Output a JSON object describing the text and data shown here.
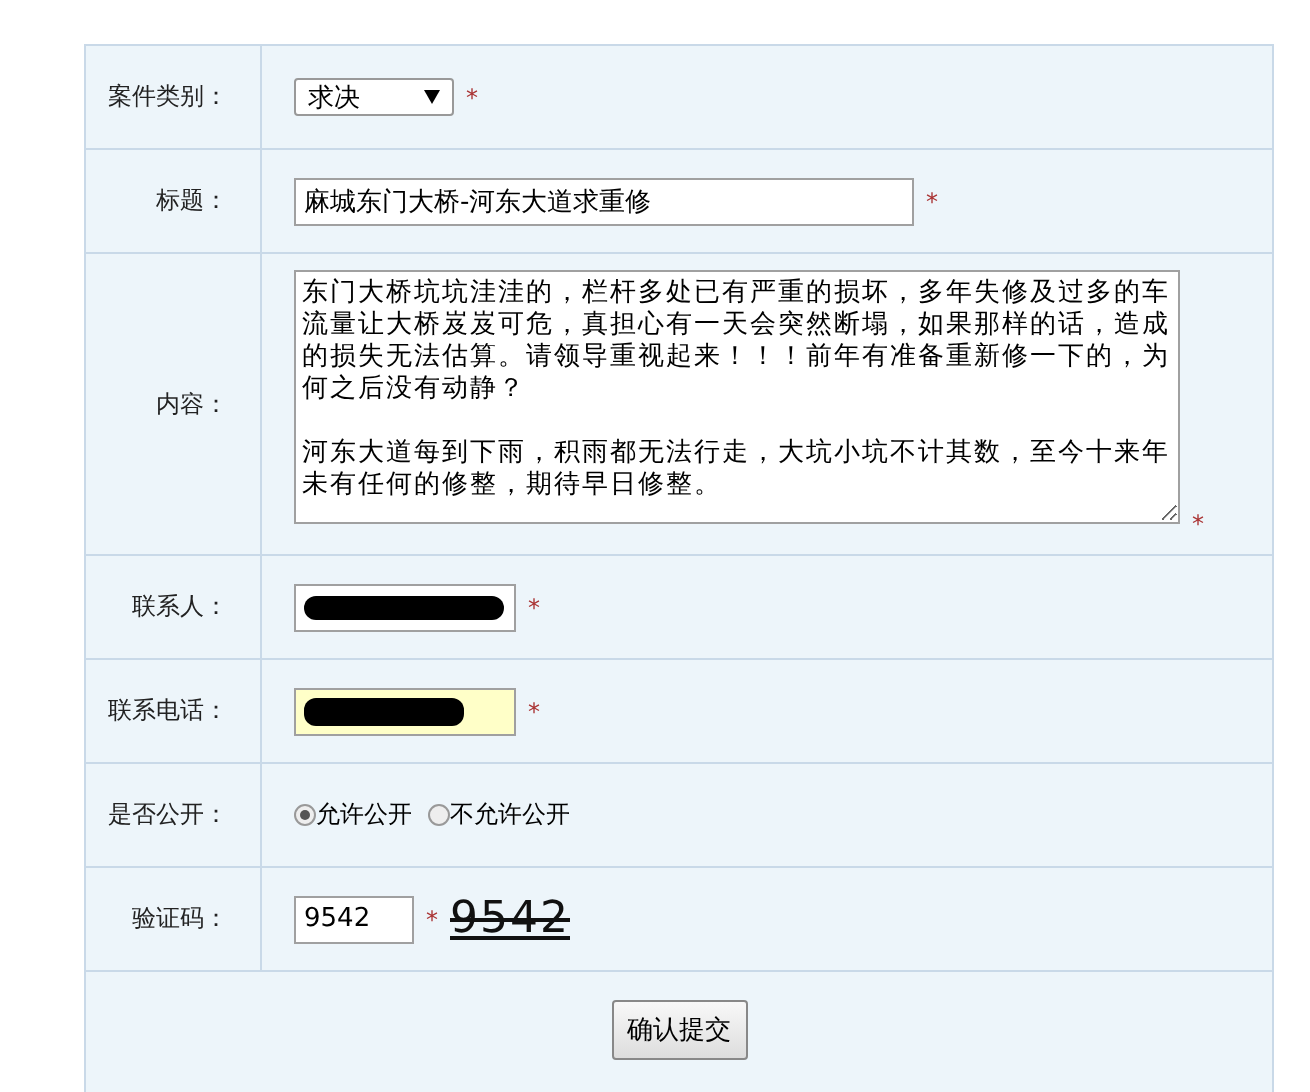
{
  "fields": [
    {
      "kind": "select",
      "label": "案件类别：",
      "value": "求决",
      "mark": "*"
    },
    {
      "kind": "text",
      "label": "标题：",
      "value": "麻城东门大桥-河东大道求重修",
      "mark": "*"
    },
    {
      "kind": "textarea",
      "label": "内容：",
      "paragraphs": [
        "东门大桥坑坑洼洼的，栏杆多处已有严重的损坏，多年失修及过多的车流量让大桥岌岌可危，真担心有一天会突然断塌，如果那样的话，造成的损失无法估算。请领导重视起来！！！前年有准备重新修一下的，为何之后没有动静？",
        "河东大道每到下雨，积雨都无法行走，大坑小坑不计其数，至今十来年未有任何的修整，期待早日修整。"
      ],
      "mark": "*"
    },
    {
      "kind": "text",
      "label": "联系人：",
      "redacted": true,
      "mark": "*"
    },
    {
      "kind": "text",
      "label": "联系电话：",
      "redacted": true,
      "highlighted": true,
      "mark": "*"
    },
    {
      "kind": "radio",
      "label": "是否公开：",
      "options": [
        {
          "label": "允许公开",
          "selected": true
        },
        {
          "label": "不允许公开",
          "selected": false
        }
      ]
    },
    {
      "kind": "captcha",
      "label": "验证码：",
      "value": "9542",
      "mark": "*",
      "captcha": "9542"
    }
  ],
  "submit": "确认提交"
}
